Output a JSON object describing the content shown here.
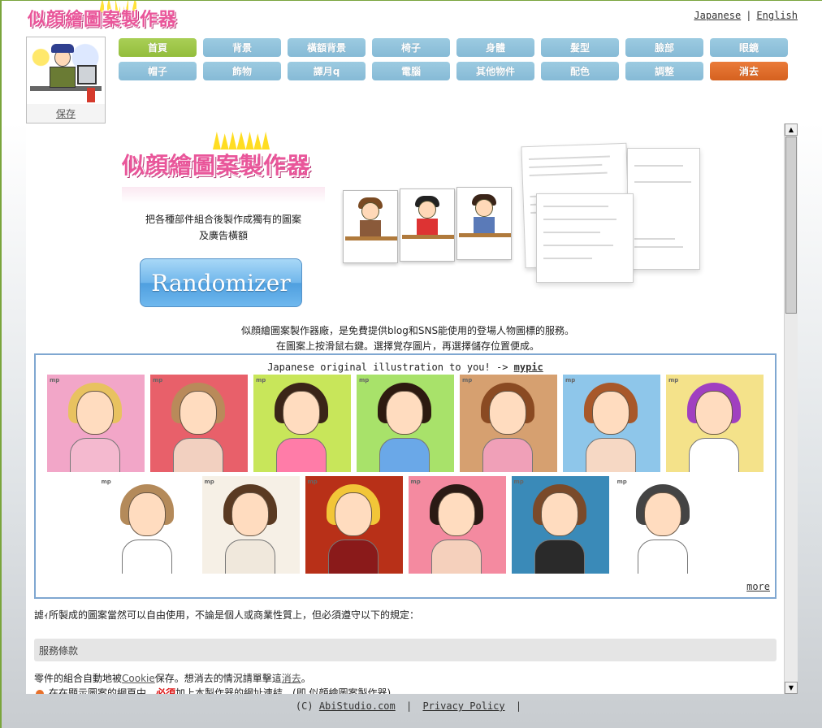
{
  "header": {
    "logo_text": "似顔繪圖案製作器",
    "lang_japanese": "Japanese",
    "lang_separator": "|",
    "lang_english": "English"
  },
  "avatar": {
    "save_label": "保存"
  },
  "nav": {
    "row1": [
      "首頁",
      "背景",
      "橫額背景",
      "椅子",
      "身體",
      "髮型",
      "臉部",
      "眼鏡"
    ],
    "row2": [
      "帽子",
      "飾物",
      "譯月q",
      "電腦",
      "其他物件",
      "配色",
      "調整",
      "消去"
    ]
  },
  "banner": {
    "logo_text": "似顔繪圖案製作器",
    "desc_line1": "把各種部件組合後製作成獨有的圖案",
    "desc_line2": "及廣告橫額",
    "randomizer_label": "Randomizer"
  },
  "intro": {
    "line1": "似顔繪圖案製作器廠，是免費提供blog和SNS能使用的登場人物圖標的服務。",
    "line2": "在圖案上按滑鼠右鍵。選擇覚存圖片，再選擇儲存位置便成。"
  },
  "illustrations": {
    "heading": "Japanese original illustration to you! ->",
    "mypic_link": "mypic",
    "more_link": "more",
    "thumb_tag": "mp",
    "row1": [
      {
        "bg": "#f2a6c8",
        "hair": "#e8c260",
        "body": "#f4b9cf"
      },
      {
        "bg": "#e8606a",
        "hair": "#b98a5a",
        "body": "#f2d0c0"
      },
      {
        "bg": "#c8e65a",
        "hair": "#3a2418",
        "body": "#ff7ca8"
      },
      {
        "bg": "#a8e26a",
        "hair": "#2d1a10",
        "body": "#6aa8e8"
      },
      {
        "bg": "#d6a070",
        "hair": "#8a4a22",
        "body": "#f0a0b8"
      },
      {
        "bg": "#8ec6ea",
        "hair": "#a8582a",
        "body": "#f6d8c4"
      },
      {
        "bg": "#f4e28a",
        "hair": "#a040c0",
        "body": "#ffffff"
      }
    ],
    "row2": [
      {
        "bg": "#ffffff",
        "hair": "#b48a5a",
        "body": "#ffffff"
      },
      {
        "bg": "#f6f0e6",
        "hair": "#5a3a22",
        "body": "#f0e8dc"
      },
      {
        "bg": "#b83018",
        "hair": "#f2c638",
        "body": "#8a1a1a"
      },
      {
        "bg": "#f48aa0",
        "hair": "#2a1a14",
        "body": "#f5d0bc"
      },
      {
        "bg": "#3a8ab8",
        "hair": "#7a4a2a",
        "body": "#2a2a2a"
      },
      {
        "bg": "#ffffff",
        "hair": "#444444",
        "body": "#ffffff"
      }
    ]
  },
  "content": {
    "usage_text": "謔ｨ所製成的圖案當然可以自由使用，不論是個人或商業性質上，但必須遵守以下的規定：",
    "terms_heading": "服務條款",
    "cookie_pre": "零件的組合自動地被",
    "cookie_link": "Cookie",
    "cookie_mid": "保存。想消去的情況請單擊這",
    "cookie_clear_link": "消去",
    "cookie_end": "。",
    "rule_pre": "在在顯示圖案的網頁中，",
    "rule_must": "必須",
    "rule_post": "加上本製作器的網址連結。(即 似顔繪圖案製作器)"
  },
  "footer": {
    "copyright": "(C)",
    "abistudio_link": "AbiStudio.com",
    "sep": "|",
    "privacy_link": "Privacy Policy",
    "sep2": "|"
  },
  "colors": {
    "home_button": "#a9cf56",
    "nav_button": "#9ccbe1",
    "clear_button": "#ea7b3a",
    "logo_pink": "#e9569a",
    "box_border": "#7fa7d1"
  }
}
